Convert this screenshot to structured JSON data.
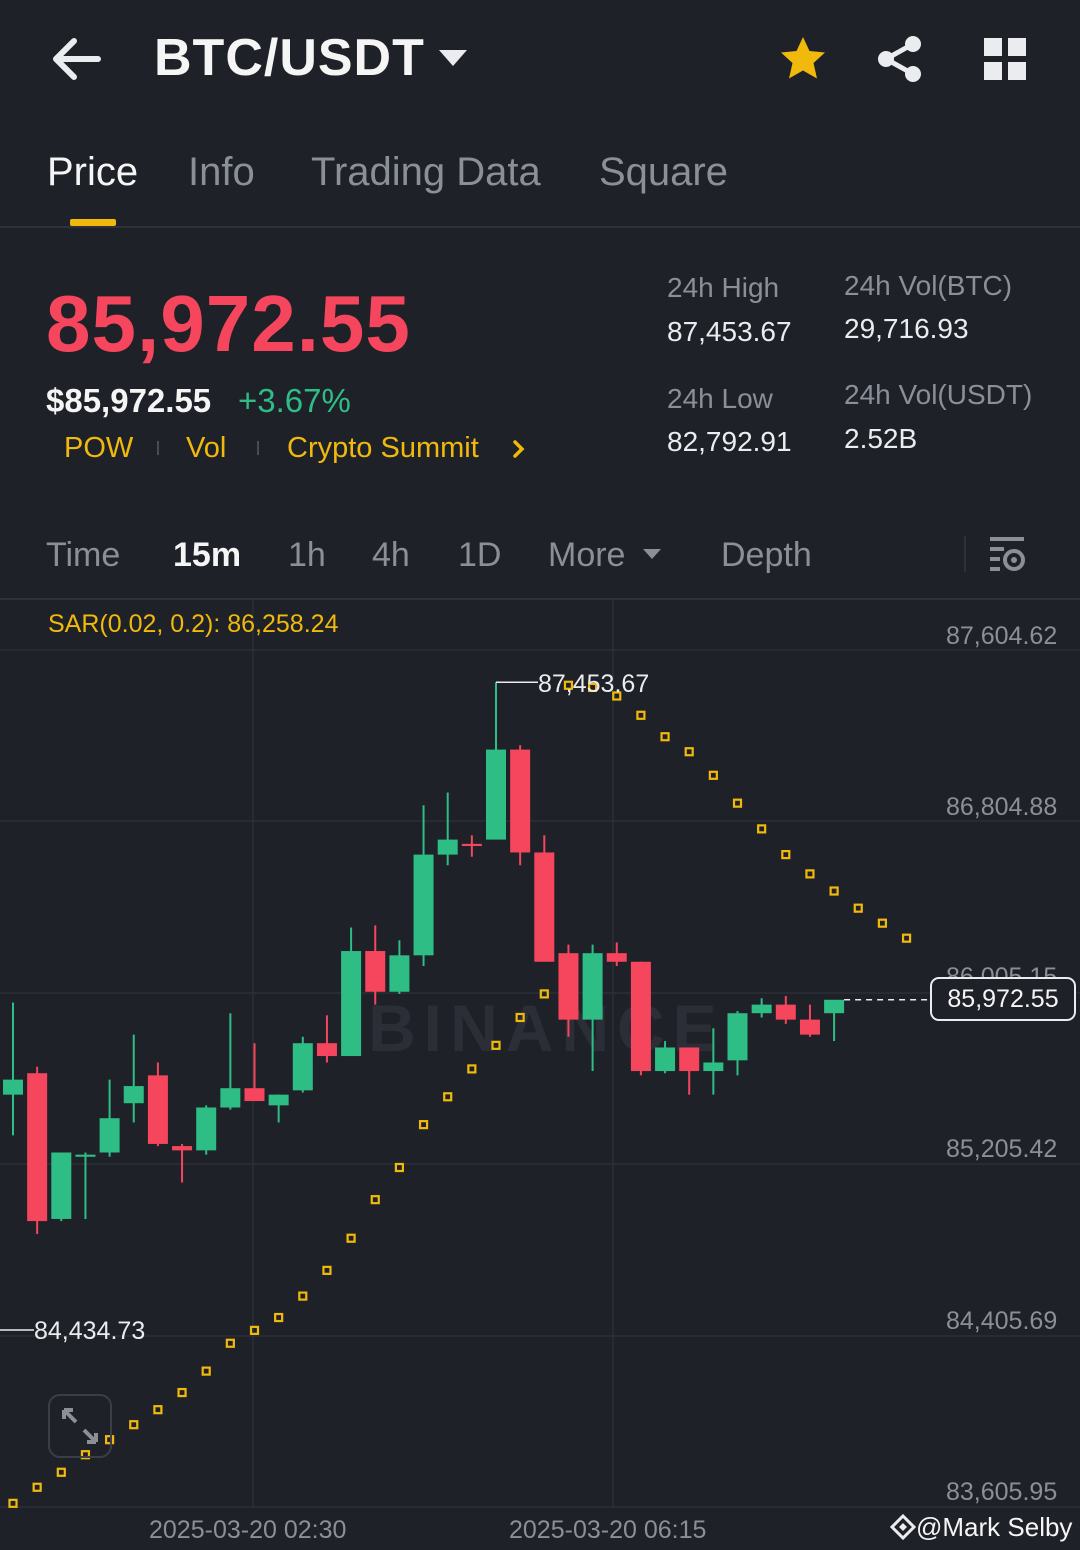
{
  "header": {
    "pair": "BTC/USDT",
    "icons": [
      "back-arrow-icon",
      "caret-down-icon",
      "star-icon",
      "share-icon",
      "grid-icon"
    ],
    "star_color": "#f0b90b"
  },
  "tabs": [
    {
      "label": "Price",
      "active": true
    },
    {
      "label": "Info",
      "active": false
    },
    {
      "label": "Trading Data",
      "active": false
    },
    {
      "label": "Square",
      "active": false
    }
  ],
  "ticker": {
    "last_price": "85,972.55",
    "usd_price": "$85,972.55",
    "change_pct": "+3.67%",
    "tags": [
      "POW",
      "Vol",
      "Crypto Summit"
    ],
    "stats": {
      "high_label": "24h High",
      "high_value": "87,453.67",
      "low_label": "24h Low",
      "low_value": "82,792.91",
      "vol_btc_label": "24h Vol(BTC)",
      "vol_btc_value": "29,716.93",
      "vol_usdt_label": "24h Vol(USDT)",
      "vol_usdt_value": "2.52B"
    }
  },
  "intervals": {
    "items": [
      "Time",
      "15m",
      "1h",
      "4h",
      "1D",
      "More",
      "Depth"
    ],
    "active": "15m"
  },
  "colors": {
    "up": "#2ebd85",
    "down": "#f6465d",
    "accent": "#f0b90b",
    "background": "#1f2128"
  },
  "chart_data": {
    "type": "candlestick",
    "indicator_label": "SAR(0.02, 0.2): 86,258.24",
    "y_axis_labels": [
      "87,604.62",
      "86,804.88",
      "86,005.15",
      "85,205.42",
      "84,405.69",
      "83,605.95"
    ],
    "ylim": [
      83605.95,
      87604.62
    ],
    "x_axis_labels": [
      "2025-03-20 02:30",
      "2025-03-20 06:15"
    ],
    "current_price": "85,972.55",
    "high_marker": "87,453.67",
    "low_marker": "84,434.73",
    "watermark": "BINANCE",
    "candles": [
      {
        "o": 85530,
        "h": 85960,
        "l": 85340,
        "c": 85600
      },
      {
        "o": 85630,
        "h": 85660,
        "l": 84880,
        "c": 84940
      },
      {
        "o": 84950,
        "h": 85250,
        "l": 84940,
        "c": 85260
      },
      {
        "o": 85240,
        "h": 85260,
        "l": 84950,
        "c": 85250
      },
      {
        "o": 85260,
        "h": 85600,
        "l": 85240,
        "c": 85420
      },
      {
        "o": 85490,
        "h": 85810,
        "l": 85400,
        "c": 85570
      },
      {
        "o": 85620,
        "h": 85680,
        "l": 85290,
        "c": 85300
      },
      {
        "o": 85290,
        "h": 85300,
        "l": 85120,
        "c": 85270
      },
      {
        "o": 85270,
        "h": 85480,
        "l": 85250,
        "c": 85470
      },
      {
        "o": 85470,
        "h": 85910,
        "l": 85460,
        "c": 85560
      },
      {
        "o": 85560,
        "h": 85770,
        "l": 85510,
        "c": 85500
      },
      {
        "o": 85480,
        "h": 85530,
        "l": 85400,
        "c": 85530
      },
      {
        "o": 85550,
        "h": 85800,
        "l": 85540,
        "c": 85770
      },
      {
        "o": 85770,
        "h": 85900,
        "l": 85680,
        "c": 85710
      },
      {
        "o": 85710,
        "h": 86310,
        "l": 85710,
        "c": 86200
      },
      {
        "o": 86200,
        "h": 86320,
        "l": 85950,
        "c": 86010
      },
      {
        "o": 86010,
        "h": 86250,
        "l": 86000,
        "c": 86180
      },
      {
        "o": 86180,
        "h": 86880,
        "l": 86130,
        "c": 86650
      },
      {
        "o": 86650,
        "h": 86940,
        "l": 86600,
        "c": 86720
      },
      {
        "o": 86700,
        "h": 86740,
        "l": 86640,
        "c": 86690
      },
      {
        "o": 86720,
        "h": 87454,
        "l": 86730,
        "c": 87140
      },
      {
        "o": 87140,
        "h": 87160,
        "l": 86600,
        "c": 86660
      },
      {
        "o": 86660,
        "h": 86740,
        "l": 86160,
        "c": 86150
      },
      {
        "o": 86190,
        "h": 86230,
        "l": 85800,
        "c": 85880
      },
      {
        "o": 85880,
        "h": 86230,
        "l": 85640,
        "c": 86190
      },
      {
        "o": 86190,
        "h": 86240,
        "l": 86130,
        "c": 86150
      },
      {
        "o": 86150,
        "h": 86150,
        "l": 85620,
        "c": 85640
      },
      {
        "o": 85640,
        "h": 85780,
        "l": 85630,
        "c": 85750
      },
      {
        "o": 85750,
        "h": 85750,
        "l": 85530,
        "c": 85640
      },
      {
        "o": 85640,
        "h": 85840,
        "l": 85530,
        "c": 85680
      },
      {
        "o": 85690,
        "h": 85920,
        "l": 85620,
        "c": 85910
      },
      {
        "o": 85910,
        "h": 85980,
        "l": 85890,
        "c": 85950
      },
      {
        "o": 85950,
        "h": 85990,
        "l": 85860,
        "c": 85880
      },
      {
        "o": 85880,
        "h": 85950,
        "l": 85800,
        "c": 85810
      },
      {
        "o": 85910,
        "h": 85950,
        "l": 85780,
        "c": 85972.55
      }
    ],
    "sar": [
      83623,
      83698,
      83768,
      83850,
      83920,
      83990,
      84060,
      84140,
      84240,
      84370,
      84430,
      84490,
      84590,
      84710,
      84860,
      85040,
      85190,
      85390,
      85520,
      85650,
      85760,
      85890,
      86000,
      87440,
      87430,
      87390,
      87300,
      87200,
      87130,
      87020,
      86890,
      86770,
      86650,
      86560,
      86480,
      86400,
      86330,
      86260
    ]
  },
  "footer": {
    "credit": "@Mark Selby"
  }
}
